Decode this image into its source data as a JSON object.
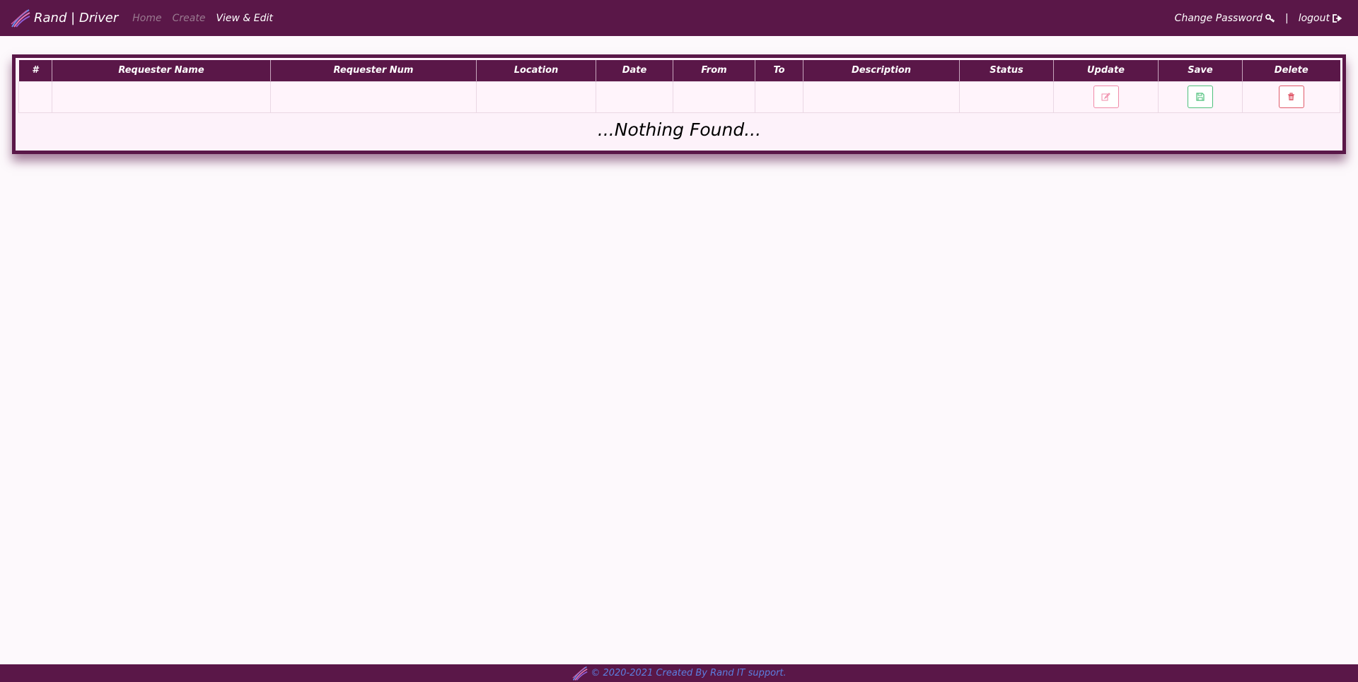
{
  "navbar": {
    "brand": "Rand | Driver",
    "links": [
      {
        "label": "Home",
        "active": false
      },
      {
        "label": "Create",
        "active": false
      },
      {
        "label": "View & Edit",
        "active": true
      }
    ],
    "change_password": "Change Password",
    "separator": "|",
    "logout": "logout"
  },
  "table": {
    "columns": [
      "#",
      "Requester Name",
      "Requester Num",
      "Location",
      "Date",
      "From",
      "To",
      "Description",
      "Status",
      "Update",
      "Save",
      "Delete"
    ],
    "empty_message": "...Nothing Found..."
  },
  "footer": {
    "text": "© 2020-2021 Created By Rand IT support."
  },
  "colors": {
    "primary": "#5a1748",
    "update_button": "#f08aa8",
    "save_button": "#4cc07a",
    "delete_button": "#e05a6a",
    "footer_text": "#5b7fe0"
  }
}
